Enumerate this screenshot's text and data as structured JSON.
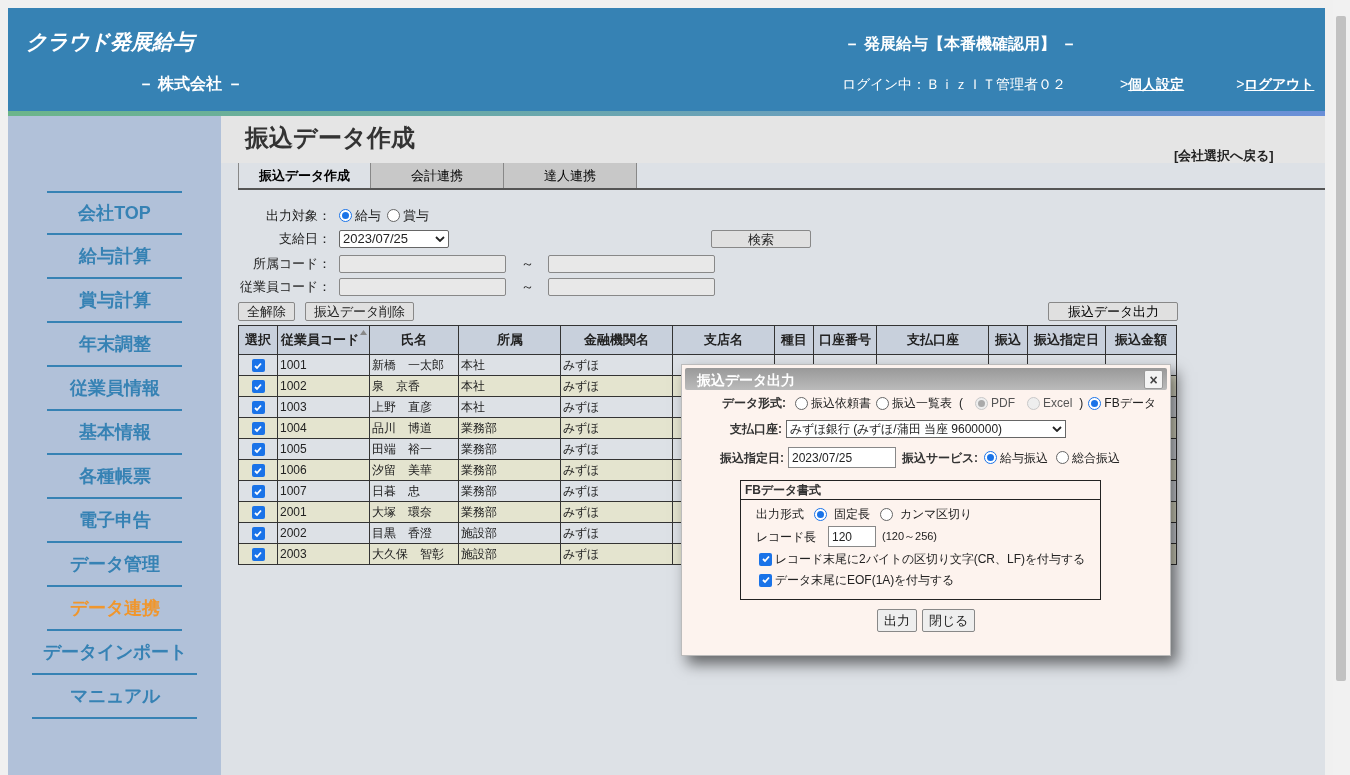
{
  "header": {
    "logo": "クラウド発展給与",
    "company": "－ 株式会社 －",
    "system_title": "－ 発展給与【本番機確認用】 －",
    "login": "ログイン中：ＢｉｚＩＴ管理者０２",
    "links": [
      {
        "marker": ">",
        "label": "個人設定"
      },
      {
        "marker": ">",
        "label": "ログアウト"
      }
    ]
  },
  "sidebar": {
    "items": [
      {
        "label": "会社TOP",
        "selected": false
      },
      {
        "label": "給与計算",
        "selected": false
      },
      {
        "label": "賞与計算",
        "selected": false
      },
      {
        "label": "年末調整",
        "selected": false
      },
      {
        "label": "従業員情報",
        "selected": false
      },
      {
        "label": "基本情報",
        "selected": false
      },
      {
        "label": "各種帳票",
        "selected": false
      },
      {
        "label": "電子申告",
        "selected": false
      },
      {
        "label": "データ管理",
        "selected": false
      },
      {
        "label": "データ連携",
        "selected": true
      },
      {
        "label": "データインポート",
        "selected": false
      },
      {
        "label": "マニュアル",
        "selected": false
      }
    ]
  },
  "page_title": "振込データ作成",
  "back_link": "[会社選択へ戻る]",
  "tabs": [
    {
      "label": "振込データ作成",
      "selected": true
    },
    {
      "label": "会計連携",
      "selected": false
    },
    {
      "label": "達人連携",
      "selected": false
    }
  ],
  "form": {
    "target_label": "出力対象：",
    "target_options": [
      {
        "label": "給与",
        "selected": true
      },
      {
        "label": "賞与",
        "selected": false
      }
    ],
    "pay_date_label": "支給日：",
    "pay_date": "2023/07/25",
    "search_button": "検索",
    "ranges": [
      {
        "label": "所属コード：",
        "separator": "～"
      },
      {
        "label": "従業員コード：",
        "separator": "～"
      }
    ],
    "buttons": [
      "全解除",
      "振込データ削除"
    ],
    "export_button": "振込データ出力"
  },
  "table": {
    "columns": [
      {
        "label": "選択",
        "sorted": false
      },
      {
        "label": "従業員コード",
        "sorted": true
      },
      {
        "label": "氏名",
        "sorted": false
      },
      {
        "label": "所属",
        "sorted": false
      },
      {
        "label": "金融機関名",
        "sorted": false
      },
      {
        "label": "支店名",
        "sorted": false
      },
      {
        "label": "種目",
        "sorted": false
      },
      {
        "label": "口座番号",
        "sorted": false
      },
      {
        "label": "支払口座",
        "sorted": false
      },
      {
        "label": "振込",
        "sorted": false
      },
      {
        "label": "振込指定日",
        "sorted": false
      },
      {
        "label": "振込金額",
        "sorted": false
      }
    ],
    "rows": [
      {
        "checked": true,
        "code": "1001",
        "name": "新橋　一太郎",
        "dept": "本社",
        "bank": "みずほ"
      },
      {
        "checked": true,
        "code": "1002",
        "name": "泉　京香",
        "dept": "本社",
        "bank": "みずほ"
      },
      {
        "checked": true,
        "code": "1003",
        "name": "上野　直彦",
        "dept": "本社",
        "bank": "みずほ"
      },
      {
        "checked": true,
        "code": "1004",
        "name": "品川　博道",
        "dept": "業務部",
        "bank": "みずほ"
      },
      {
        "checked": true,
        "code": "1005",
        "name": "田端　裕一",
        "dept": "業務部",
        "bank": "みずほ"
      },
      {
        "checked": true,
        "code": "1006",
        "name": "汐留　美華",
        "dept": "業務部",
        "bank": "みずほ"
      },
      {
        "checked": true,
        "code": "1007",
        "name": "日暮　忠",
        "dept": "業務部",
        "bank": "みずほ"
      },
      {
        "checked": true,
        "code": "2001",
        "name": "大塚　環奈",
        "dept": "業務部",
        "bank": "みずほ"
      },
      {
        "checked": true,
        "code": "2002",
        "name": "目黒　香澄",
        "dept": "施設部",
        "bank": "みずほ"
      },
      {
        "checked": true,
        "code": "2003",
        "name": "大久保　智彰",
        "dept": "施設部",
        "bank": "みずほ"
      }
    ]
  },
  "dialog": {
    "title": "振込データ出力",
    "close": "×",
    "format_label": "データ形式:",
    "format_options": [
      {
        "label": "振込依頼書",
        "selected": false
      },
      {
        "label": "振込一覧表",
        "selected": false,
        "open": "(",
        "close": ")",
        "children": [
          {
            "label": "PDF",
            "selected": true,
            "disabled": true
          },
          {
            "label": "Excel",
            "selected": false,
            "disabled": true
          }
        ]
      },
      {
        "label": "FBデータ",
        "selected": true
      }
    ],
    "account_label": "支払口座:",
    "account": "みずほ銀行 (みずほ/蒲田 当座 9600000)",
    "date_label": "振込指定日:",
    "date": "2023/07/25",
    "service_label": "振込サービス:",
    "service_options": [
      {
        "label": "給与振込",
        "selected": true
      },
      {
        "label": "総合振込",
        "selected": false
      }
    ],
    "fb": {
      "title": "FBデータ書式",
      "mode_label": "出力形式",
      "mode_options": [
        {
          "label": "固定長",
          "selected": true
        },
        {
          "label": "カンマ区切り",
          "selected": false
        }
      ],
      "length_label": "レコード長",
      "length": "120",
      "length_hint": "(120～256)",
      "checks": [
        {
          "label": "レコード末尾に2バイトの区切り文字(CR、LF)を付与する",
          "checked": true
        },
        {
          "label": "データ末尾にEOF(1A)を付与する",
          "checked": true
        }
      ]
    },
    "buttons": [
      "出力",
      "閉じる"
    ]
  }
}
